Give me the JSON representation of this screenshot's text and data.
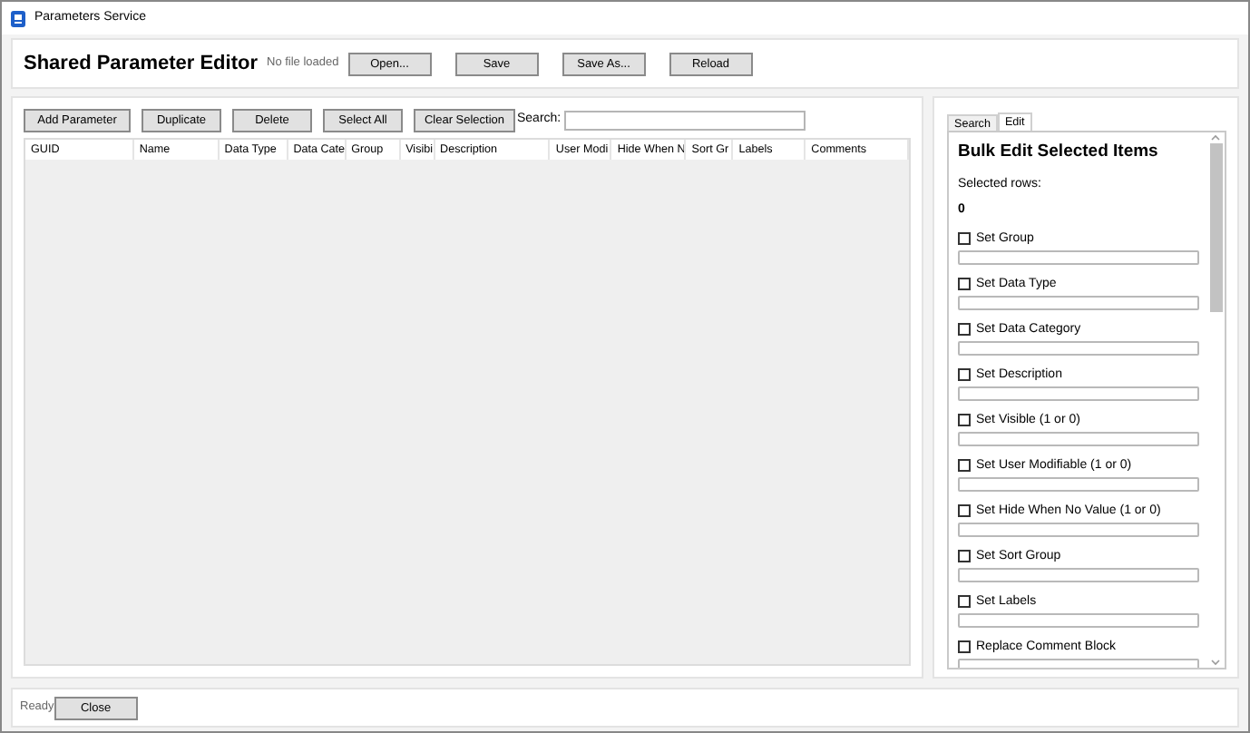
{
  "window": {
    "title": "Parameters Service"
  },
  "header": {
    "title": "Shared Parameter Editor",
    "file_status": "No file loaded",
    "buttons": [
      "Open...",
      "Save",
      "Save As...",
      "Reload"
    ]
  },
  "toolbar": {
    "buttons": [
      "Add Parameter",
      "Duplicate",
      "Delete",
      "Select All",
      "Clear Selection"
    ],
    "search_label": "Search:"
  },
  "table": {
    "columns": [
      "GUID",
      "Name",
      "Data Type",
      "Data Cate",
      "Group",
      "Visibi",
      "Description",
      "User Modi",
      "Hide When N",
      "Sort Gr",
      "Labels",
      "Comments"
    ]
  },
  "side_panel": {
    "tabs": [
      {
        "label": "Search",
        "selected": false
      },
      {
        "label": "Edit",
        "selected": true
      }
    ],
    "title": "Bulk Edit Selected Items",
    "selected_rows_label": "Selected rows:",
    "selected_rows_value": "0",
    "fields": [
      {
        "label": "Set Group",
        "checked": false
      },
      {
        "label": "Set Data Type",
        "checked": false
      },
      {
        "label": "Set Data Category",
        "checked": false
      },
      {
        "label": "Set Description",
        "checked": false
      },
      {
        "label": "Set Visible (1 or 0)",
        "checked": false
      },
      {
        "label": "Set User Modifiable (1 or 0)",
        "checked": false
      },
      {
        "label": "Set Hide When No Value (1 or 0)",
        "checked": false
      },
      {
        "label": "Set Sort Group",
        "checked": false
      },
      {
        "label": "Set Labels",
        "checked": false
      },
      {
        "label": "Replace Comment Block",
        "checked": false
      }
    ]
  },
  "status_bar": {
    "text": "Ready",
    "button": "Close"
  }
}
